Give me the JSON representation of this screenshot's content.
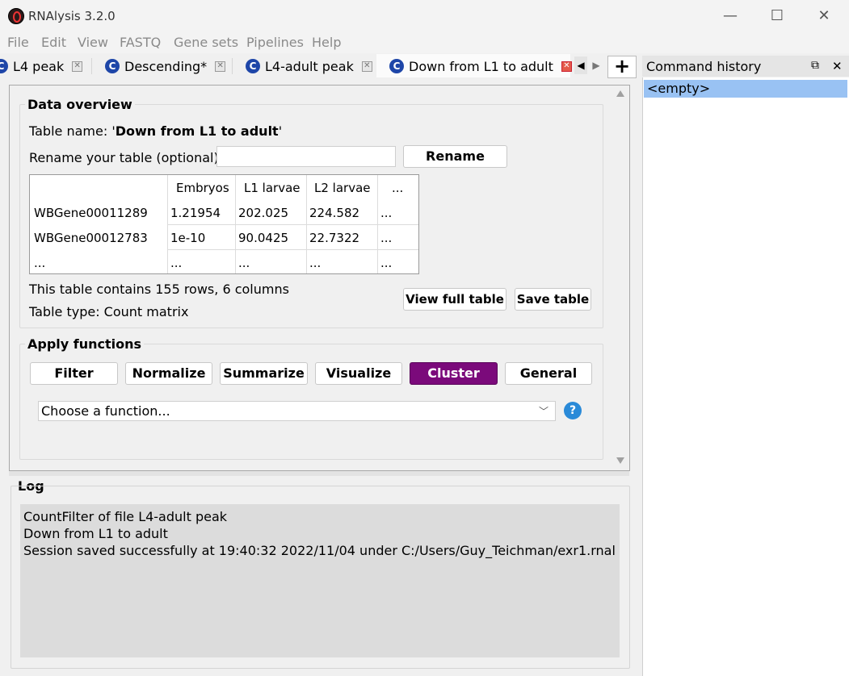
{
  "window": {
    "title": "RNAlysis 3.2.0",
    "controls": {
      "minimize": "—",
      "maximize": "☐",
      "close": "✕"
    }
  },
  "menu": [
    "File",
    "Edit",
    "View",
    "FASTQ",
    "Gene sets",
    "Pipelines",
    "Help"
  ],
  "tabs": [
    {
      "label": "L4 peak",
      "icon": "C",
      "active": false
    },
    {
      "label": "Descending*",
      "icon": "C",
      "active": false
    },
    {
      "label": "L4-adult peak",
      "icon": "C",
      "active": false
    },
    {
      "label": "Down from L1 to adult",
      "icon": "C",
      "active": true
    }
  ],
  "tab_controls": {
    "prev": "◀",
    "next": "▶",
    "add": "+"
  },
  "data_overview": {
    "title": "Data overview",
    "table_name_label": "Table name: '",
    "table_name": "Down from L1 to adult",
    "table_name_suffix": "'",
    "rename_label": "Rename your table (optional):",
    "rename_value": "",
    "rename_button": "Rename",
    "table": {
      "headers": [
        "",
        "Embryos",
        "L1 larvae",
        "L2 larvae",
        "..."
      ],
      "rows": [
        [
          "WBGene00011289",
          "1.21954",
          "202.025",
          "224.582",
          "..."
        ],
        [
          "WBGene00012783",
          "1e-10",
          "90.0425",
          "22.7322",
          "..."
        ],
        [
          "...",
          "...",
          "...",
          "...",
          "..."
        ]
      ]
    },
    "row_info": "This table contains 155 rows, 6 columns",
    "table_type": "Table type: Count matrix",
    "view_full_button": "View full table",
    "save_button": "Save table"
  },
  "apply_functions": {
    "title": "Apply functions",
    "buttons": [
      "Filter",
      "Normalize",
      "Summarize",
      "Visualize",
      "Cluster",
      "General"
    ],
    "active_button": "Cluster",
    "active_color": "#7b0a7b",
    "function_select": "Choose a function...",
    "help_icon": "?"
  },
  "log": {
    "title": "Log",
    "lines": [
      "CountFilter of file L4-adult peak",
      "Down from L1 to adult",
      "Session saved successfully at 19:40:32 2022/11/04 under C:/Users/Guy_Teichman/exr1.rnal"
    ]
  },
  "command_history": {
    "title": "Command history",
    "items": [
      "<empty>"
    ],
    "float_icon": "⧉",
    "close_icon": "✕"
  }
}
